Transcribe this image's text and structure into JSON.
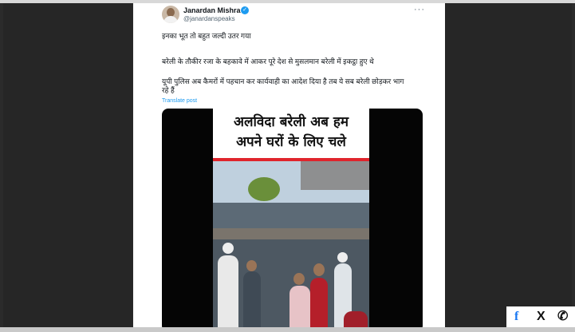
{
  "tweet": {
    "author_name": "Janardan Mishra",
    "handle": "@janardanspeaks",
    "more_icon": "more-dots-icon",
    "lines": [
      "इनका भूत तो बहुत जल्दी उतर गया",
      "बरेली के तौकीर रजा के बहकावे में आकर पूरे देश से मुसलमान बरेली में इकट्ठा हुए थे",
      "यूपी पुलिस अब कैमरों में पहचान कर कार्यवाही का आदेश दिया है तब ये सब बरेली छोड़कर भाग रहे हैं"
    ],
    "translate_label": "Translate post",
    "video_caption": [
      "अलविदा बरेली अब हम",
      "अपने घरों के लिए चले"
    ]
  },
  "share_bar": {
    "facebook": "f",
    "x": "X",
    "whatsapp": "✆"
  },
  "colors": {
    "accent": "#1d9bf0",
    "caption_bar": "#e0242c",
    "facebook": "#1877f2"
  }
}
